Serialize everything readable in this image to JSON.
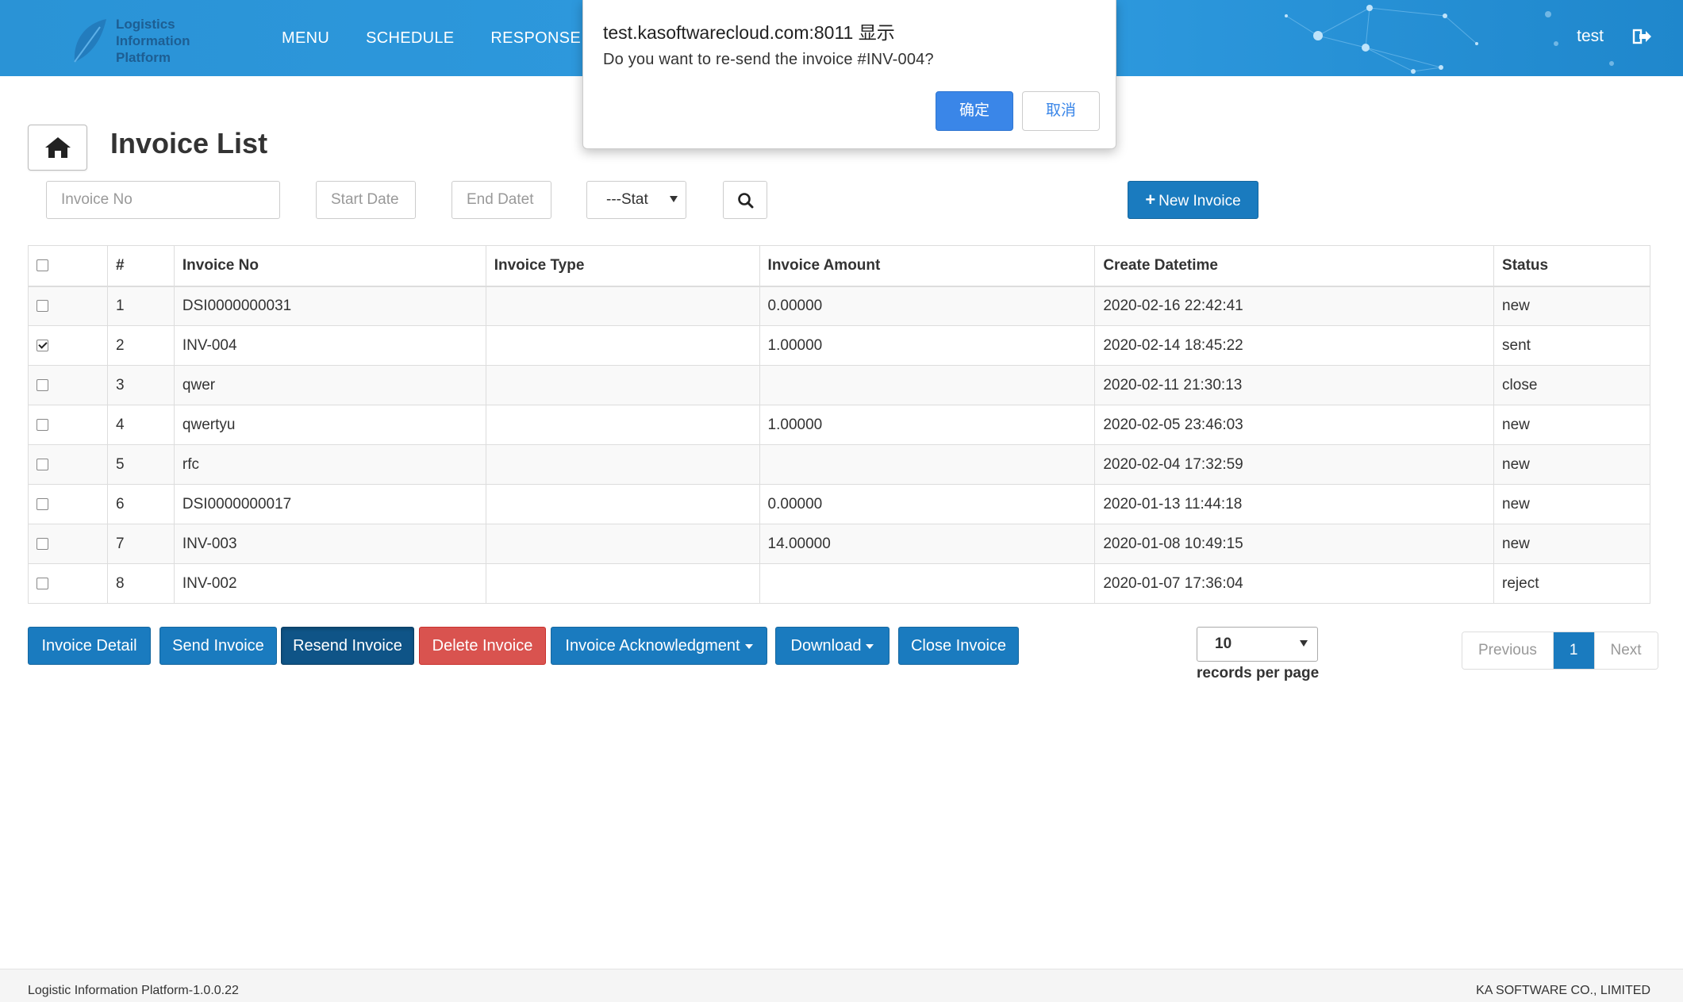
{
  "header": {
    "logo_lines": [
      "Logistics",
      "Information",
      "Platform"
    ],
    "nav": [
      "MENU",
      "SCHEDULE",
      "RESPONSE"
    ],
    "user": "test",
    "logout_icon": "sign-out-icon",
    "brand_color": "#2a93d6"
  },
  "page": {
    "title": "Invoice List",
    "home_icon": "home-icon"
  },
  "filters": {
    "invoice_no_placeholder": "Invoice No",
    "start_date_placeholder": "Start Date",
    "end_date_placeholder": "End Datet",
    "status_selected": "---Stat",
    "search_icon": "search-icon",
    "new_invoice": "New Invoice",
    "new_invoice_icon": "plus-icon"
  },
  "table": {
    "columns": [
      "#",
      "Invoice No",
      "Invoice Type",
      "Invoice Amount",
      "Create Datetime",
      "Status"
    ],
    "rows": [
      {
        "num": "1",
        "invoice_no": "DSI0000000031",
        "type": "",
        "amount": "0.00000",
        "created": "2020-02-16 22:42:41",
        "status": "new",
        "checked": false
      },
      {
        "num": "2",
        "invoice_no": "INV-004",
        "type": "",
        "amount": "1.00000",
        "created": "2020-02-14 18:45:22",
        "status": "sent",
        "checked": true
      },
      {
        "num": "3",
        "invoice_no": "qwer",
        "type": "",
        "amount": "",
        "created": "2020-02-11 21:30:13",
        "status": "close",
        "checked": false
      },
      {
        "num": "4",
        "invoice_no": "qwertyu",
        "type": "",
        "amount": "1.00000",
        "created": "2020-02-05 23:46:03",
        "status": "new",
        "checked": false
      },
      {
        "num": "5",
        "invoice_no": "rfc",
        "type": "",
        "amount": "",
        "created": "2020-02-04 17:32:59",
        "status": "new",
        "checked": false
      },
      {
        "num": "6",
        "invoice_no": "DSI0000000017",
        "type": "",
        "amount": "0.00000",
        "created": "2020-01-13 11:44:18",
        "status": "new",
        "checked": false
      },
      {
        "num": "7",
        "invoice_no": "INV-003",
        "type": "",
        "amount": "14.00000",
        "created": "2020-01-08 10:49:15",
        "status": "new",
        "checked": false
      },
      {
        "num": "8",
        "invoice_no": "INV-002",
        "type": "",
        "amount": "",
        "created": "2020-01-07 17:36:04",
        "status": "reject",
        "checked": false
      }
    ]
  },
  "actions": {
    "invoice_detail": "Invoice Detail",
    "send_invoice": "Send Invoice",
    "resend_invoice": "Resend Invoice",
    "delete_invoice": "Delete Invoice",
    "invoice_ack": "Invoice Acknowledgment",
    "download": "Download",
    "close_invoice": "Close Invoice"
  },
  "pagination": {
    "per_page": "10",
    "per_page_label": "records per page",
    "previous": "Previous",
    "current": "1",
    "next": "Next"
  },
  "footer": {
    "left": "Logistic Information Platform-1.0.0.22",
    "right": "KA SOFTWARE CO., LIMITED"
  },
  "dialog": {
    "title": "test.kasoftwarecloud.com:8011 显示",
    "message": "Do you want to re-send the invoice #INV-004?",
    "ok": "确定",
    "cancel": "取消"
  }
}
